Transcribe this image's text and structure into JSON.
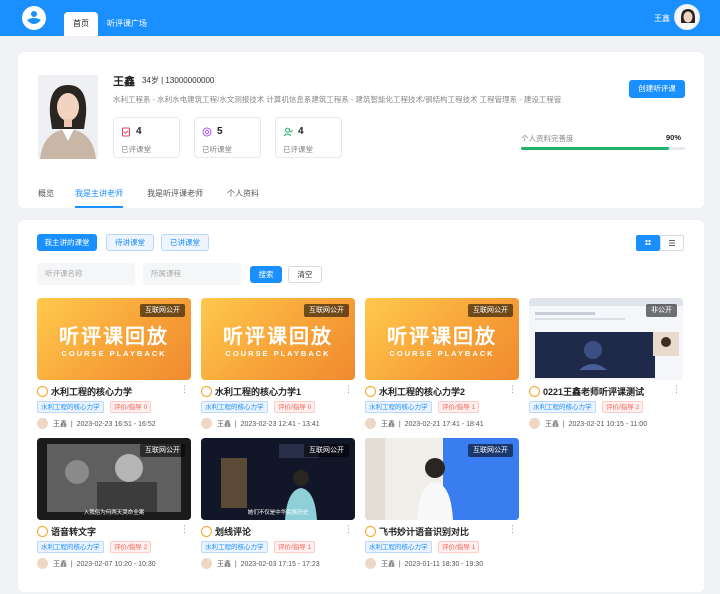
{
  "header": {
    "tabs": [
      "首页",
      "听评课广场"
    ],
    "user_name": "王鑫"
  },
  "profile": {
    "name": "王鑫",
    "age_phone": "34岁 | 13000000000",
    "skills": "水利工程系 - 水利水电建筑工程/水文测报技术    计算机信息系建筑工程系 - 建筑智能化工程技术/钢结构工程技术    工程管理系 - 建设工程管",
    "stats": [
      {
        "icon": "evaluated-icon",
        "value": "4",
        "label": "已评课堂",
        "color": "#f5365c"
      },
      {
        "icon": "listened-icon",
        "value": "5",
        "label": "已听课堂",
        "color": "#a855f7"
      },
      {
        "icon": "user-icon",
        "value": "4",
        "label": "已评课堂",
        "color": "#21b36a"
      }
    ],
    "create_button": "创建听评课",
    "completeness_label": "个人资料完善度",
    "completeness_value": "90%",
    "completeness_fraction": 0.9,
    "subtabs": [
      "概览",
      "我是主讲老师",
      "我是听评课老师",
      "个人资料"
    ]
  },
  "main": {
    "filters": [
      "我主讲的课堂",
      "待讲课堂",
      "已讲课堂"
    ],
    "search_placeholder": "听评课名称",
    "course_placeholder": "所属课程",
    "search_button": "搜索",
    "clear_button": "清空",
    "playback_title": "听评课回放",
    "playback_subtitle": "COURSE PLAYBACK",
    "courses": [
      {
        "title": "水利工程的核心力学",
        "badge": "互联网公开",
        "tag1": "水利工程的核心力学",
        "tag2": "评价/指导 0",
        "teacher": "王鑫",
        "time": "2023-02-23 16:51 - 16:52",
        "thumb": "playback"
      },
      {
        "title": "水利工程的核心力学1",
        "badge": "互联网公开",
        "tag1": "水利工程的核心力学",
        "tag2": "评价/指导 0",
        "teacher": "王鑫",
        "time": "2023-02-23 12:41 - 13:41",
        "thumb": "playback"
      },
      {
        "title": "水利工程的核心力学2",
        "badge": "互联网公开",
        "tag1": "水利工程的核心力学",
        "tag2": "评价/指导 1",
        "teacher": "王鑫",
        "time": "2023-02-21 17:41 - 18:41",
        "thumb": "playback"
      },
      {
        "title": "0221王鑫老师听评课测试",
        "badge": "非公开",
        "tag1": "水利工程的核心力学",
        "tag2": "评价/指导 2",
        "teacher": "王鑫",
        "time": "2023-02-21 10:15 - 11:00",
        "thumb": "screen"
      },
      {
        "title": "语音转文字",
        "badge": "互联网公开",
        "tag1": "水利工程的核心力学",
        "tag2": "评价/指导 2",
        "teacher": "王鑫",
        "time": "2023-02-07 10:20 - 10:30",
        "thumb": "video-bw",
        "caption": "入我俗为何两天哭命全案"
      },
      {
        "title": "划线评论",
        "badge": "互联网公开",
        "tag1": "水利工程的核心力学",
        "tag2": "评价/指导 1",
        "teacher": "王鑫",
        "time": "2023-02-03 17:15 - 17:23",
        "thumb": "video-dark",
        "caption": "她们不仅是中华民族历史"
      },
      {
        "title": "飞书妙计语音识别对比",
        "badge": "互联网公开",
        "tag1": "水利工程的核心力学",
        "tag2": "评价/指导 1",
        "teacher": "王鑫",
        "time": "2023-01-11 18:30 - 19:30",
        "thumb": "video-blue"
      }
    ]
  }
}
